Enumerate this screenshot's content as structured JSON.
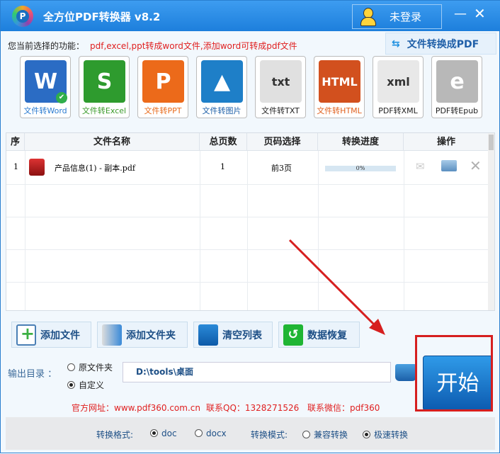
{
  "app": {
    "title": "全方位PDF转换器 v8.2",
    "login_label": "未登录",
    "logo_letter": "P"
  },
  "function": {
    "label": "您当前选择的功能：",
    "value": "pdf,excel,ppt转成word文件,添加word可转成pdf文件",
    "to_pdf_button": "文件转换成PDF"
  },
  "tiles": [
    {
      "label": "文件转Word",
      "glyph": "W",
      "color": "#2b6cc4",
      "label_color": "#2b7bd0"
    },
    {
      "label": "文件转Excel",
      "glyph": "S",
      "color": "#2e9b2e",
      "label_color": "#3a9a2a"
    },
    {
      "label": "文件转PPT",
      "glyph": "P",
      "color": "#ec6a1a",
      "label_color": "#e86a1a"
    },
    {
      "label": "文件转图片",
      "glyph": "▲",
      "color": "#1e7fc8",
      "label_color": "#1d5fa8"
    },
    {
      "label": "文件转TXT",
      "glyph": "txt",
      "color": "#e0e0e0",
      "label_color": "#222222"
    },
    {
      "label": "文件转HTML",
      "glyph": "HTML",
      "color": "#d2501e",
      "label_color": "#e0601e"
    },
    {
      "label": "PDF转XML",
      "glyph": "xml",
      "color": "#e8e8e8",
      "label_color": "#222222"
    },
    {
      "label": "PDF转Epub",
      "glyph": "e",
      "color": "#b8b8b8",
      "label_color": "#222222"
    }
  ],
  "table": {
    "headers": [
      "序",
      "文件名称",
      "总页数",
      "页码选择",
      "转换进度",
      "操作"
    ],
    "rows": [
      {
        "index": "1",
        "name": "产品信息(1) - 副本.pdf",
        "pages": "1",
        "page_select": "前3页",
        "progress_text": "0%",
        "progress": 0
      }
    ]
  },
  "actions": {
    "add_file": "添加文件",
    "add_folder": "添加文件夹",
    "clear_list": "清空列表",
    "data_recovery": "数据恢复"
  },
  "output": {
    "label": "输出目录 ：",
    "option_original": "原文件夹",
    "option_custom": "自定义",
    "path": "D:\\tools\\桌面",
    "start": "开始"
  },
  "contact": {
    "website": "官方网址：www.pdf360.com.cn",
    "qq": "联系QQ：1328271526",
    "wechat": "联系微信：pdf360"
  },
  "settings": {
    "format_label": "转换格式:",
    "format_doc": "doc",
    "format_docx": "docx",
    "mode_label": "转换模式:",
    "mode_compat": "兼容转换",
    "mode_fast": "极速转换"
  }
}
